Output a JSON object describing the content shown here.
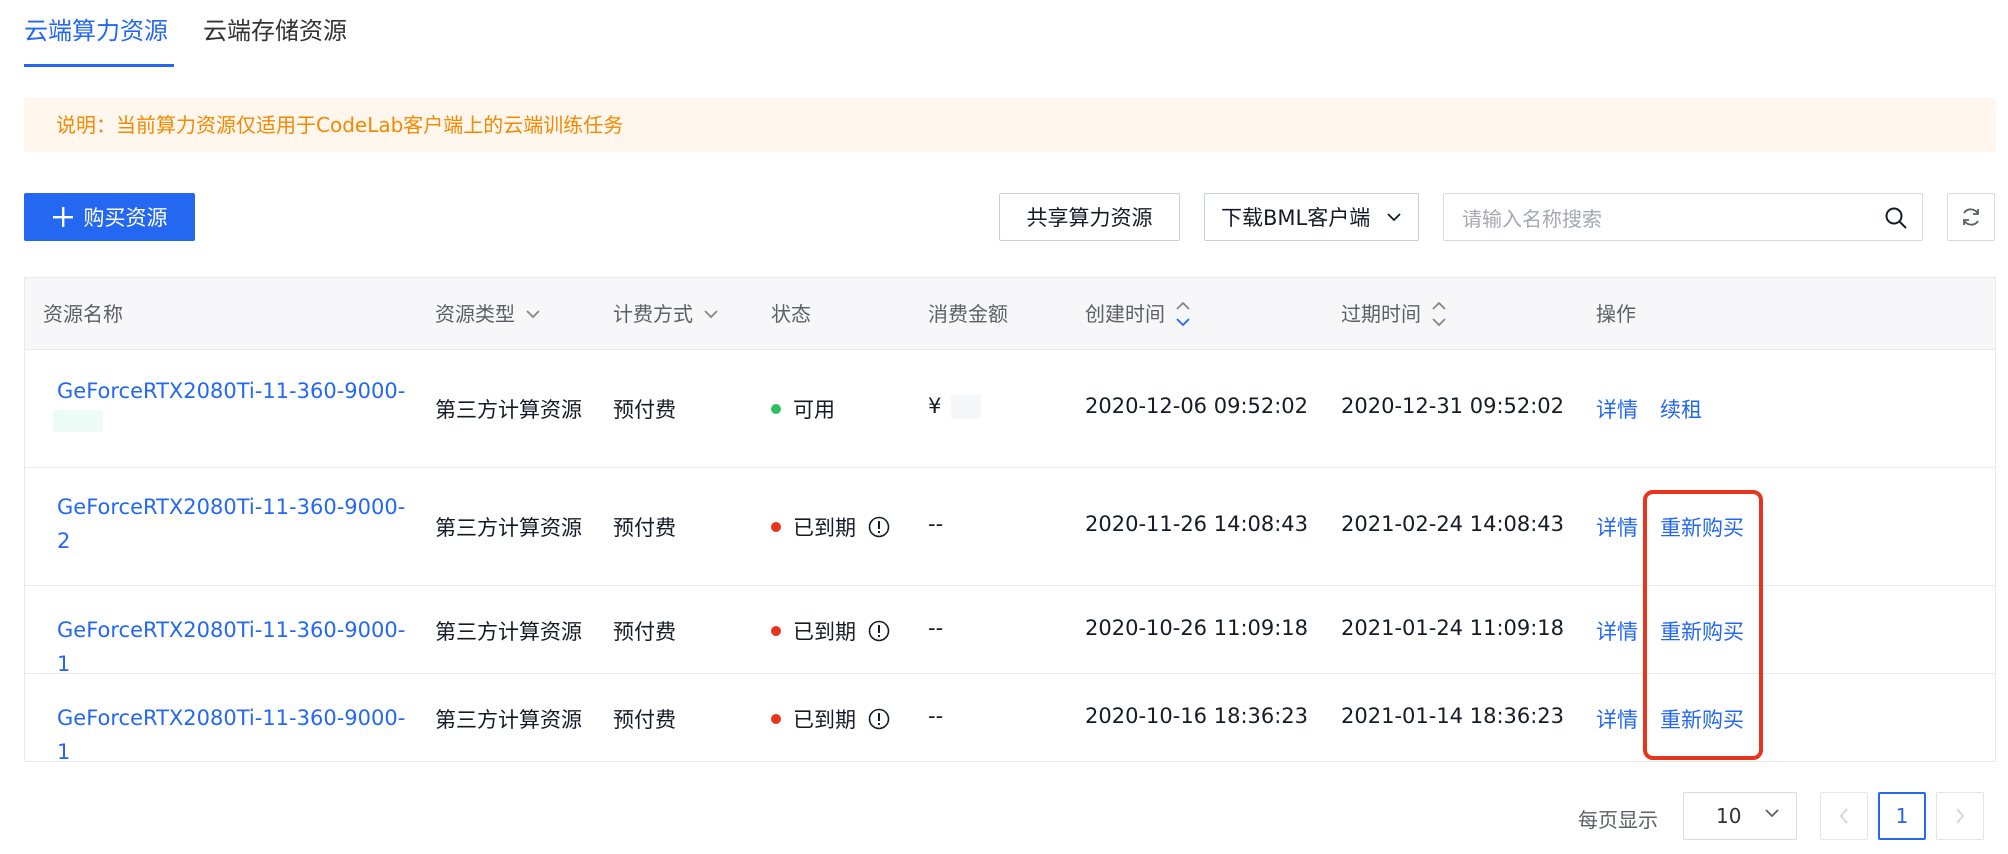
{
  "tabs": [
    {
      "label": "云端算力资源",
      "active": true
    },
    {
      "label": "云端存储资源",
      "active": false
    }
  ],
  "notice": "说明：当前算力资源仅适用于CodeLab客户端上的云端训练任务",
  "toolbar": {
    "buy_label": "购买资源",
    "share_label": "共享算力资源",
    "download_label": "下载BML客户端",
    "search_placeholder": "请输入名称搜索"
  },
  "table": {
    "headers": {
      "name": "资源名称",
      "type": "资源类型",
      "billing": "计费方式",
      "status": "状态",
      "amount": "消费金额",
      "created": "创建时间",
      "expire": "过期时间",
      "ops": "操作"
    },
    "rows": [
      {
        "name": "GeForceRTX2080Ti-11-360-9000-1",
        "type": "第三方计算资源",
        "billing": "预付费",
        "status": "可用",
        "amount": "¥",
        "created": "2020-12-06 09:52:02",
        "expire": "2020-12-31 09:52:02",
        "op1": "详情",
        "op2": "续租"
      },
      {
        "name": "GeForceRTX2080Ti-11-360-9000-2",
        "type": "第三方计算资源",
        "billing": "预付费",
        "status": "已到期",
        "amount": "--",
        "created": "2020-11-26 14:08:43",
        "expire": "2021-02-24 14:08:43",
        "op1": "详情",
        "op2": "重新购买"
      },
      {
        "name": "GeForceRTX2080Ti-11-360-9000-1",
        "type": "第三方计算资源",
        "billing": "预付费",
        "status": "已到期",
        "amount": "--",
        "created": "2020-10-26 11:09:18",
        "expire": "2021-01-24 11:09:18",
        "op1": "详情",
        "op2": "重新购买"
      },
      {
        "name": "GeForceRTX2080Ti-11-360-9000-1",
        "type": "第三方计算资源",
        "billing": "预付费",
        "status": "已到期",
        "amount": "--",
        "created": "2020-10-16 18:36:23",
        "expire": "2021-01-14 18:36:23",
        "op1": "详情",
        "op2": "重新购买"
      }
    ]
  },
  "pagination": {
    "per_page_label": "每页显示",
    "page_size": "10",
    "current_page": "1"
  },
  "colors": {
    "primary": "#2468f2",
    "status_available": "#30bf62",
    "status_expired": "#e8341c",
    "notice_bg": "#fff6ee",
    "notice_text": "#f38900",
    "highlight": "#e8341c"
  },
  "icons": [
    "plus-icon",
    "chevron-down-icon",
    "search-icon",
    "refresh-icon",
    "sort-icon",
    "warning-circle-icon",
    "chevron-left-icon",
    "chevron-right-icon"
  ]
}
